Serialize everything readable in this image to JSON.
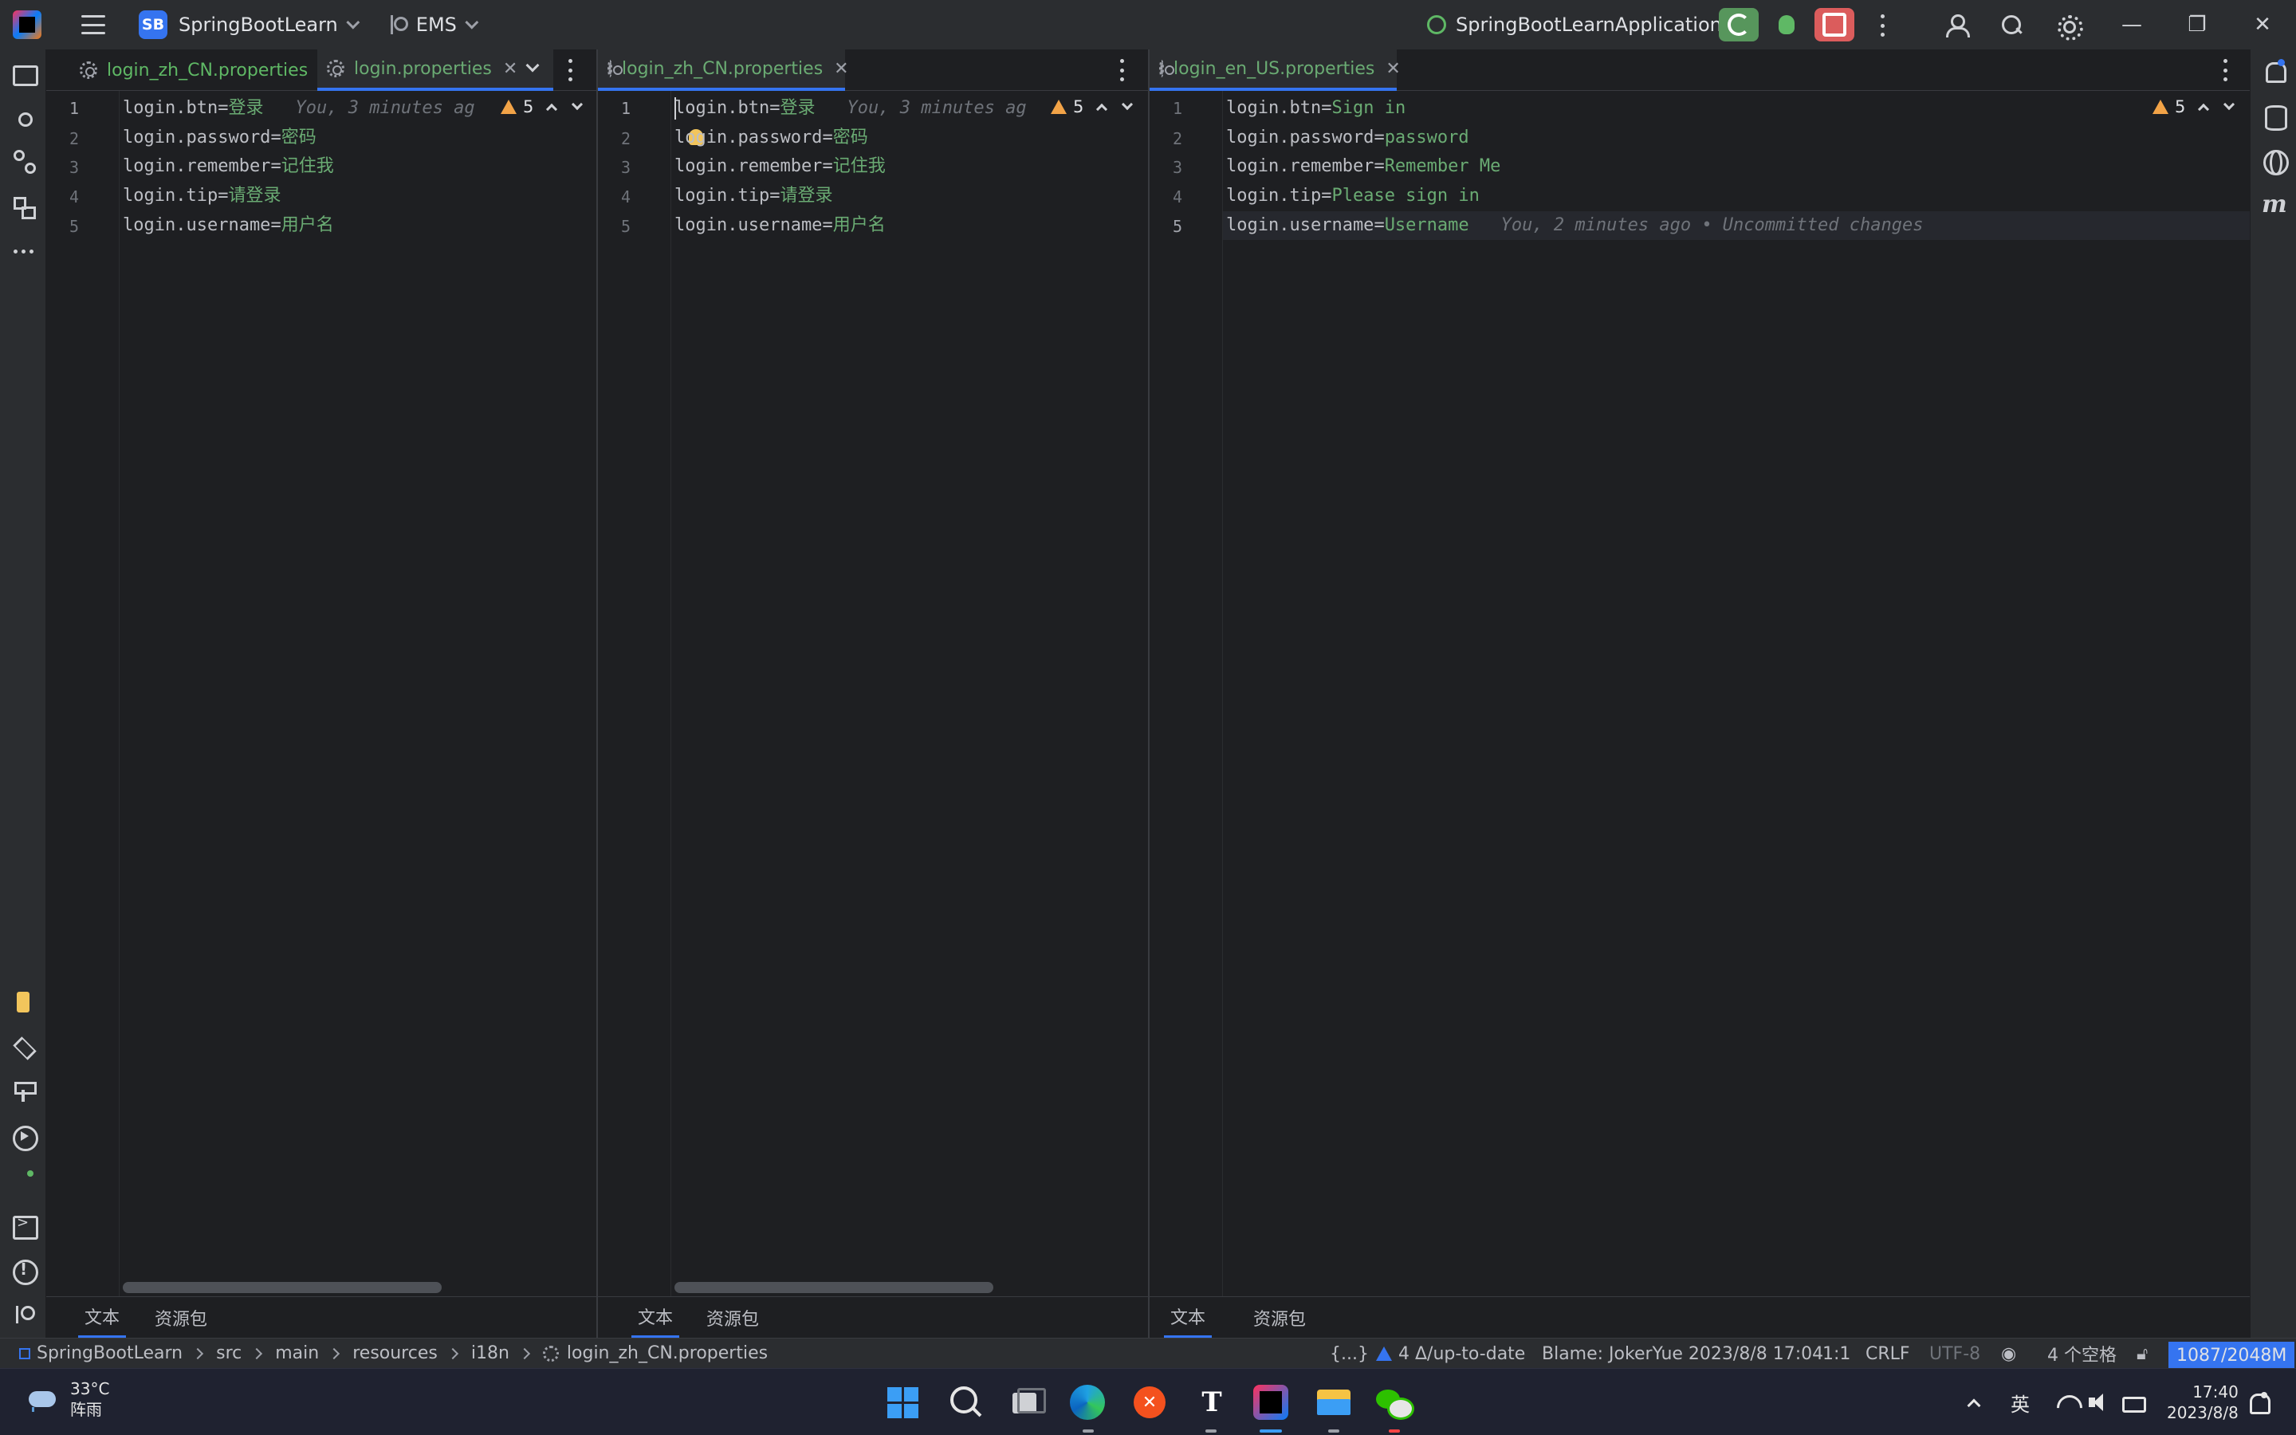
{
  "titlebar": {
    "project_badge": "SB",
    "project_name": "SpringBootLearn",
    "branch": "EMS",
    "run_config": "SpringBootLearnApplication",
    "window_controls": {
      "minimize": "—",
      "restore": "❐",
      "close": "✕"
    }
  },
  "panes": [
    {
      "tabs": [
        {
          "label": "login_zh_CN.properties",
          "active": false,
          "closable": false
        },
        {
          "label": "login.properties",
          "active": true,
          "closable": true
        }
      ],
      "warnings": "5",
      "lines": [
        {
          "n": "1",
          "key": "login.btn",
          "val": "登录",
          "blame": "You, 3 minutes ag"
        },
        {
          "n": "2",
          "key": "login.password",
          "val": "密码"
        },
        {
          "n": "3",
          "key": "login.remember",
          "val": "记住我"
        },
        {
          "n": "4",
          "key": "login.tip",
          "val": "请登录"
        },
        {
          "n": "5",
          "key": "login.username",
          "val": "用户名"
        }
      ],
      "bottom_tabs": [
        "文本",
        "资源包"
      ]
    },
    {
      "tabs": [
        {
          "label": "login_zh_CN.properties",
          "active": true,
          "closable": true
        }
      ],
      "warnings": "5",
      "lines": [
        {
          "n": "1",
          "key": "login.btn",
          "val": "登录",
          "blame": "You, 3 minutes ag"
        },
        {
          "n": "2",
          "key": "login.password",
          "val": "密码"
        },
        {
          "n": "3",
          "key": "login.remember",
          "val": "记住我"
        },
        {
          "n": "4",
          "key": "login.tip",
          "val": "请登录"
        },
        {
          "n": "5",
          "key": "login.username",
          "val": "用户名"
        }
      ],
      "bottom_tabs": [
        "文本",
        "资源包"
      ]
    },
    {
      "tabs": [
        {
          "label": "login_en_US.properties",
          "active": true,
          "closable": true
        }
      ],
      "warnings": "5",
      "lines": [
        {
          "n": "1",
          "key": "login.btn",
          "val": "Sign in"
        },
        {
          "n": "2",
          "key": "login.password",
          "val": "password"
        },
        {
          "n": "3",
          "key": "login.remember",
          "val": "Remember Me"
        },
        {
          "n": "4",
          "key": "login.tip",
          "val": "Please sign in"
        },
        {
          "n": "5",
          "key": "login.username",
          "val": "Username",
          "blame": "You, 2 minutes ago • Uncommitted changes"
        }
      ],
      "bottom_tabs": [
        "文本",
        "资源包"
      ]
    }
  ],
  "statusbar": {
    "breadcrumbs": [
      "SpringBootLearn",
      "src",
      "main",
      "resources",
      "i18n",
      "login_zh_CN.properties"
    ],
    "braces": "{...}",
    "vcs_status": "4 Δ/up-to-date",
    "blame": "Blame: JokerYue 2023/8/8 17:04",
    "position": "1:1",
    "line_sep": "CRLF",
    "encoding": "UTF-8",
    "indent": "4 个空格",
    "memory": "1087/2048M"
  },
  "taskbar": {
    "temperature": "33°C",
    "weather": "阵雨",
    "ime": "英",
    "time": "17:40",
    "date": "2023/8/8",
    "apps": [
      "windows-start",
      "search",
      "task-view",
      "edge",
      "x-app",
      "typora",
      "intellij-idea",
      "file-explorer",
      "wechat"
    ],
    "typora_glyph": "T",
    "x_glyph": "✕"
  },
  "colors": {
    "accent": "#3574f0",
    "value_green": "#6aab73",
    "warning": "#f2a347",
    "rerun": "#57965c",
    "stop": "#db5c5c"
  }
}
